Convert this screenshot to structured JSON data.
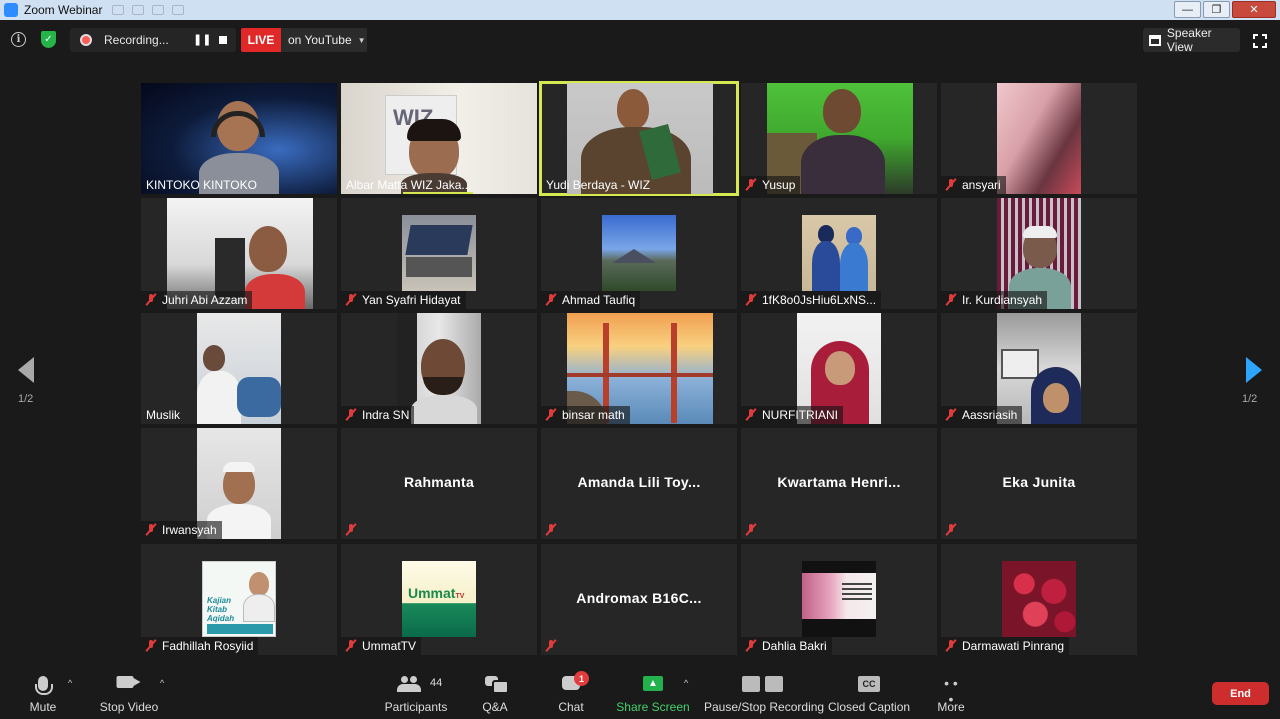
{
  "window": {
    "title": "Zoom Webinar",
    "controls": [
      "—",
      "❐",
      "✕"
    ]
  },
  "topbar": {
    "recording_label": "Recording...",
    "live_label": "LIVE",
    "stream_target": "on YouTube",
    "view_label": "Speaker View"
  },
  "participants": [
    {
      "name": "KINTOKO KINTOKO",
      "muted": false,
      "video": true
    },
    {
      "name": "Albar Matta WIZ Jaka...",
      "muted": false,
      "video": true
    },
    {
      "name": "Yudi Berdaya - WIZ",
      "muted": false,
      "video": true,
      "active": true
    },
    {
      "name": "Yusup",
      "muted": true,
      "video": true
    },
    {
      "name": "ansyari",
      "muted": true,
      "video": true
    },
    {
      "name": "Juhri Abi Azzam",
      "muted": true,
      "video": true
    },
    {
      "name": "Yan Syafri Hidayat",
      "muted": true,
      "video": true
    },
    {
      "name": "Ahmad Taufiq",
      "muted": true,
      "video": true
    },
    {
      "name": "1fK8o0JsHiu6LxNS...",
      "muted": true,
      "video": true
    },
    {
      "name": "Ir. Kurdiansyah",
      "muted": true,
      "video": true
    },
    {
      "name": "Muslik",
      "muted": false,
      "video": true
    },
    {
      "name": "Indra SN",
      "muted": true,
      "video": true
    },
    {
      "name": "binsar math",
      "muted": true,
      "video": true
    },
    {
      "name": "NURFITRIANI",
      "muted": true,
      "video": true
    },
    {
      "name": "Aassriasih",
      "muted": true,
      "video": true
    },
    {
      "name": "Irwansyah",
      "muted": true,
      "video": true
    },
    {
      "name": "Rahmanta",
      "muted": true,
      "video": false
    },
    {
      "name": "Amanda Lili Toy...",
      "muted": true,
      "video": false
    },
    {
      "name": "Kwartama Henri...",
      "muted": true,
      "video": false
    },
    {
      "name": "Eka Junita",
      "muted": true,
      "video": false
    },
    {
      "name": "Fadhillah Rosyiid",
      "muted": true,
      "video": true
    },
    {
      "name": "UmmatTV",
      "muted": true,
      "video": true
    },
    {
      "name": "Andromax B16C...",
      "muted": true,
      "video": false
    },
    {
      "name": "Dahlia Bakri",
      "muted": true,
      "video": true
    },
    {
      "name": "Darmawati Pinrang",
      "muted": true,
      "video": true
    }
  ],
  "thumb_text": {
    "wiz_banner": "WIZ",
    "kajian_poster": "Kajian Kitab Aqidah",
    "ummat_logo": "Ummat",
    "ummat_suffix": "TV"
  },
  "pagination": {
    "left": "1/2",
    "right": "1/2"
  },
  "bottombar": {
    "mute": "Mute",
    "stop_video": "Stop Video",
    "participants": "Participants",
    "participant_count": "44",
    "qa": "Q&A",
    "chat": "Chat",
    "chat_badge": "1",
    "share_screen": "Share Screen",
    "pause_stop_recording": "Pause/Stop Recording",
    "closed_caption": "Closed Caption",
    "cc_glyph": "CC",
    "more": "More",
    "end": "End"
  },
  "colors": {
    "active_speaker": "#d6e84f",
    "live": "#e02828",
    "share_green": "#22b14c",
    "end_red": "#cd2d2d",
    "muted_red": "#e23b3b",
    "next_arrow": "#2da5ff"
  }
}
